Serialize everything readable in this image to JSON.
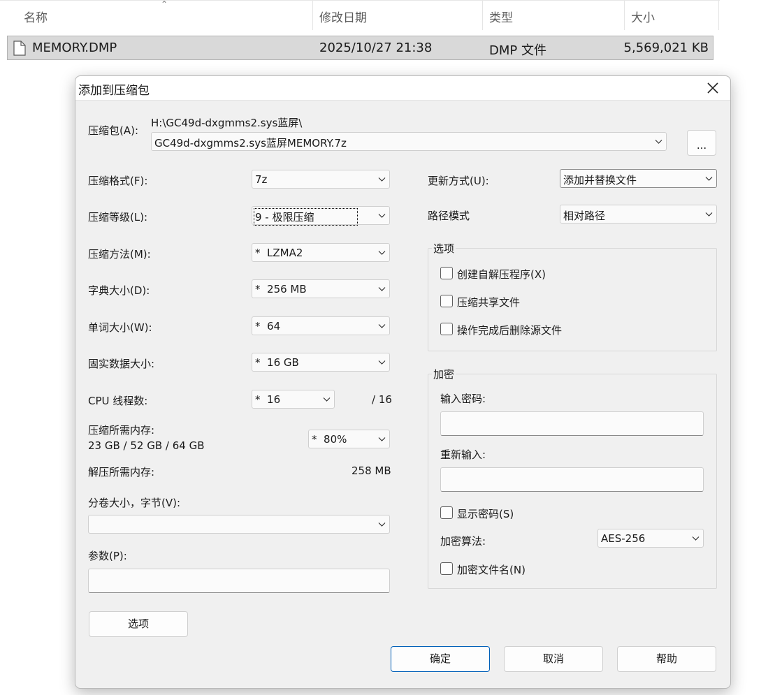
{
  "explorer": {
    "columns": {
      "name": "名称",
      "modified": "修改日期",
      "type": "类型",
      "size": "大小"
    },
    "file": {
      "name": "MEMORY.DMP",
      "modified": "2025/10/27 21:38",
      "type": "DMP 文件",
      "size": "5,569,021 KB"
    }
  },
  "dialog": {
    "title": "添加到压缩包",
    "archive": {
      "label": "压缩包(A):",
      "folder": "H:\\GC49d-dxgmms2.sys蓝屏\\",
      "filename": "GC49d-dxgmms2.sys蓝屏MEMORY.7z",
      "browse_label": "..."
    },
    "left": {
      "format": {
        "label": "压缩格式(F):",
        "value": "7z"
      },
      "level": {
        "label": "压缩等级(L):",
        "value": "9 - 极限压缩"
      },
      "method": {
        "label": "压缩方法(M):",
        "value": "*  LZMA2"
      },
      "dict": {
        "label": "字典大小(D):",
        "value": "*  256 MB"
      },
      "word": {
        "label": "单词大小(W):",
        "value": "*  64"
      },
      "solid": {
        "label": "固实数据大小:",
        "value": "*  16 GB"
      },
      "threads": {
        "label": "CPU 线程数:",
        "value": "*  16",
        "max": "/ 16"
      },
      "mem_compress": {
        "label": "压缩所需内存:",
        "detail": "23 GB / 52 GB / 64 GB",
        "value": "*  80%"
      },
      "mem_decompress": {
        "label": "解压所需内存:",
        "value": "258 MB"
      },
      "volume": {
        "label": "分卷大小，字节(V):",
        "value": ""
      },
      "params": {
        "label": "参数(P):",
        "value": ""
      },
      "options_button": "选项"
    },
    "right": {
      "update_mode": {
        "label": "更新方式(U):",
        "value": "添加并替换文件"
      },
      "path_mode": {
        "label": "路径模式",
        "value": "相对路径"
      },
      "options_group": {
        "title": "选项",
        "sfx": "创建自解压程序(X)",
        "shared": "压缩共享文件",
        "delete_after": "操作完成后删除源文件"
      },
      "encryption_group": {
        "title": "加密",
        "password_label": "输入密码:",
        "reenter_label": "重新输入:",
        "show_password": "显示密码(S)",
        "method_label": "加密算法:",
        "method_value": "AES-256",
        "encrypt_names": "加密文件名(N)"
      }
    },
    "buttons": {
      "ok": "确定",
      "cancel": "取消",
      "help": "帮助"
    }
  }
}
